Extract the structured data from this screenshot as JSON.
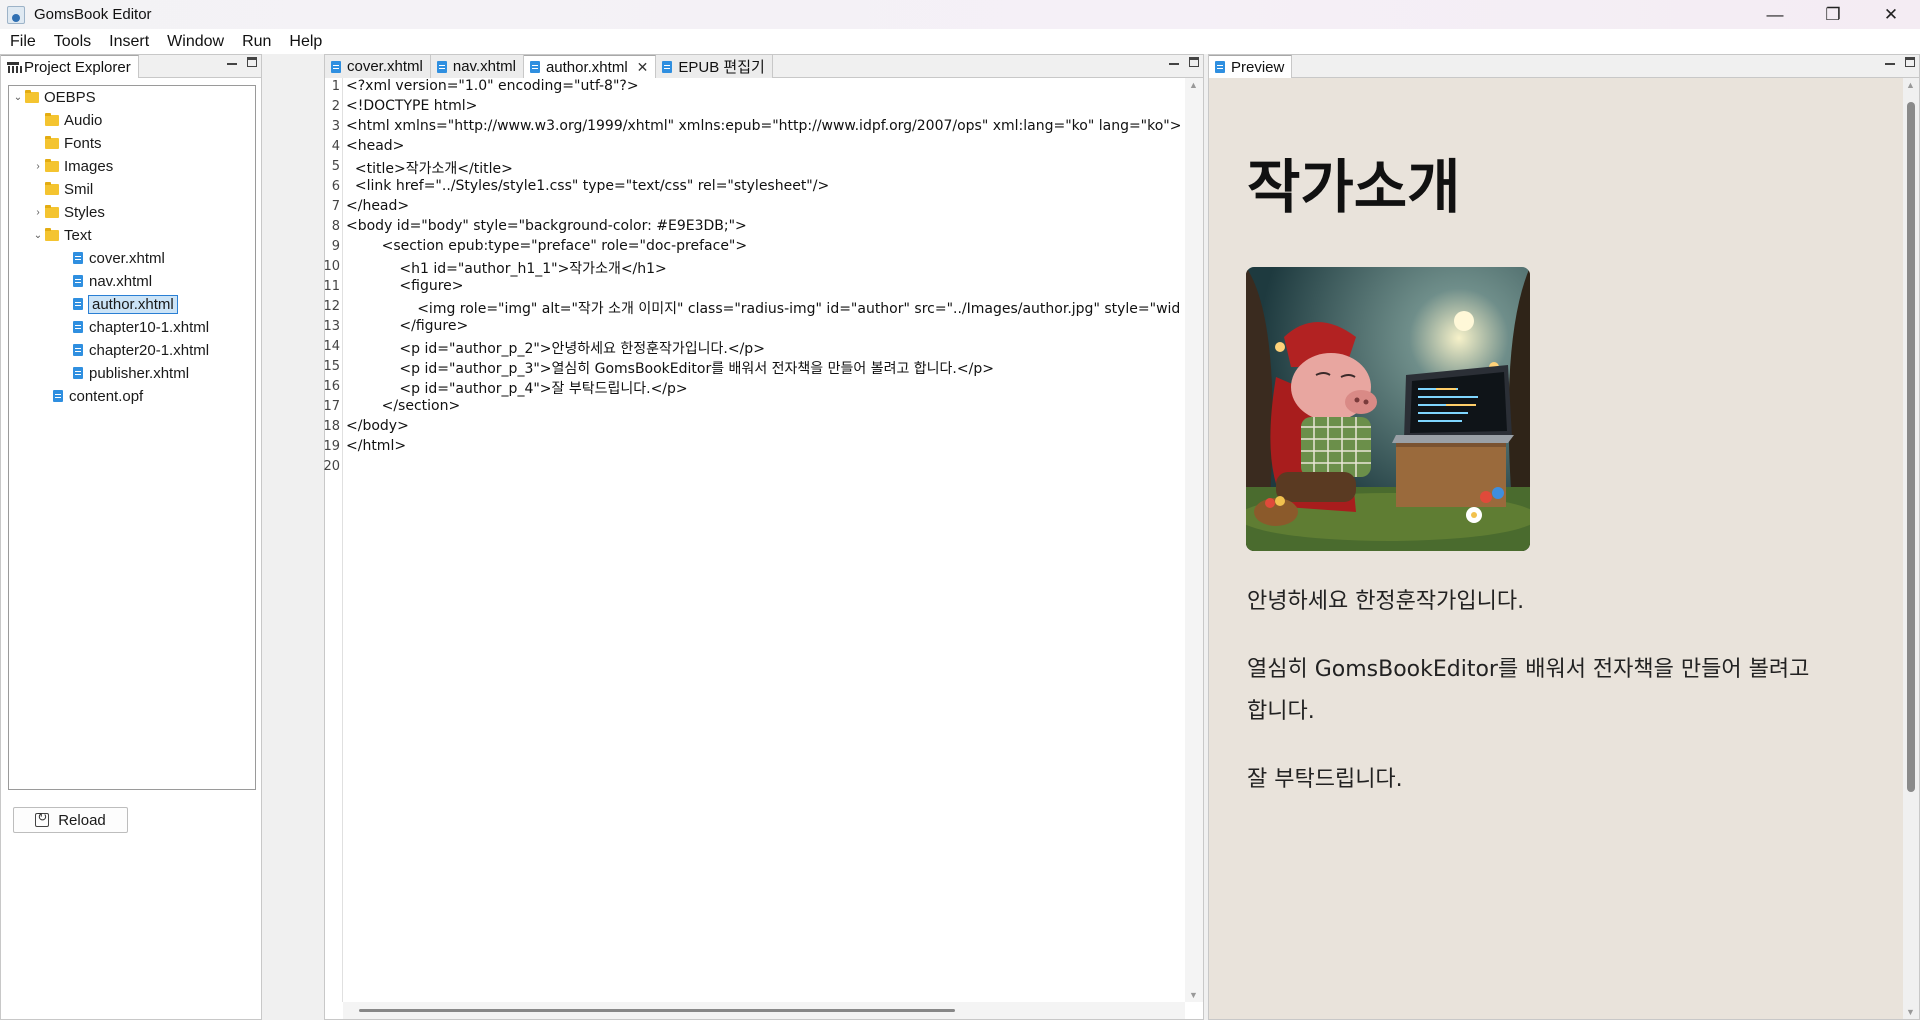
{
  "window": {
    "title": "GomsBook Editor",
    "min": "—",
    "max": "❐",
    "close": "✕"
  },
  "menu": [
    "File",
    "Tools",
    "Insert",
    "Window",
    "Run",
    "Help"
  ],
  "explorer": {
    "tab_label": "Project Explorer",
    "tree": {
      "root": "OEBPS",
      "audio": "Audio",
      "fonts": "Fonts",
      "images": "Images",
      "smil": "Smil",
      "styles": "Styles",
      "text": "Text",
      "files": [
        "cover.xhtml",
        "nav.xhtml",
        "author.xhtml",
        "chapter10-1.xhtml",
        "chapter20-1.xhtml",
        "publisher.xhtml"
      ],
      "content": "content.opf"
    },
    "reload_label": "Reload"
  },
  "editor": {
    "tabs": [
      "cover.xhtml",
      "nav.xhtml",
      "author.xhtml",
      "EPUB 편집기"
    ],
    "active_tab_close": "✕",
    "line_numbers": [
      "1",
      "2",
      "3",
      "4",
      "5",
      "6",
      "7",
      "8",
      "9",
      "10",
      "11",
      "12",
      "13",
      "14",
      "15",
      "16",
      "17",
      "18",
      "19",
      "20"
    ],
    "lines": [
      "<?xml version=\"1.0\" encoding=\"utf-8\"?>",
      "<!DOCTYPE html>",
      "<html xmlns=\"http://www.w3.org/1999/xhtml\" xmlns:epub=\"http://www.idpf.org/2007/ops\" xml:lang=\"ko\" lang=\"ko\">",
      "<head>",
      "  <title>작가소개</title>",
      "  <link href=\"../Styles/style1.css\" type=\"text/css\" rel=\"stylesheet\"/>",
      "</head>",
      "<body id=\"body\" style=\"background-color: #E9E3DB;\">",
      "        <section epub:type=\"preface\" role=\"doc-preface\">",
      "            <h1 id=\"author_h1_1\">작가소개</h1>",
      "            <figure>",
      "                <img role=\"img\" alt=\"작가 소개 이미지\" class=\"radius-img\" id=\"author\" src=\"../Images/author.jpg\" style=\"wid",
      "            </figure>",
      "            <p id=\"author_p_2\">안녕하세요 한정훈작가입니다.</p>",
      "            <p id=\"author_p_3\">열심히 GomsBookEditor를 배워서 전자책을 만들어 볼려고 합니다.</p>",
      "            <p id=\"author_p_4\">잘 부탁드립니다.</p>",
      "        </section>",
      "</body>",
      "</html>",
      ""
    ]
  },
  "preview": {
    "tab_label": "Preview",
    "background": "#E9E3DB",
    "heading": "작가소개",
    "image_alt": "작가 소개 이미지",
    "paragraphs": [
      "안녕하세요 한정훈작가입니다.",
      "열심히 GomsBookEditor를 배워서 전자책을 만들어 볼려고",
      "합니다.",
      "잘 부탁드립니다."
    ]
  },
  "colors": {
    "selection": "#cce4f7",
    "folder": "#f4c430",
    "file": "#2f8fe0"
  }
}
